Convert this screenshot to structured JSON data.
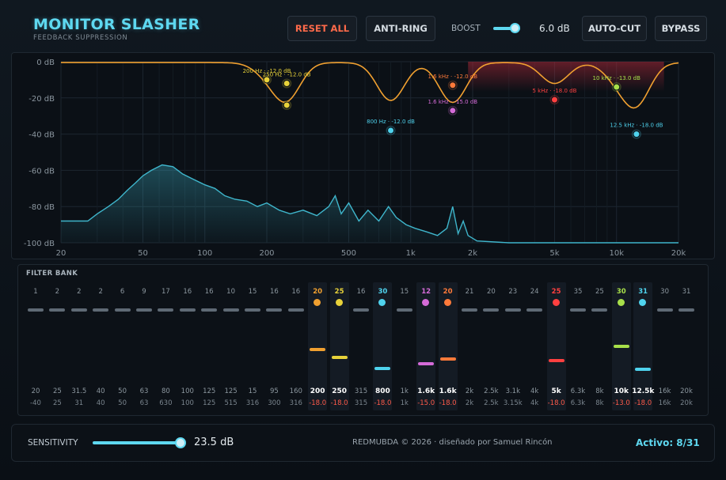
{
  "app": {
    "title": "MONITOR SLASHER",
    "subtitle": "FEEDBACK SUPPRESSION"
  },
  "toolbar": {
    "reset_label": "RESET ALL",
    "antiring_label": "ANTI-RING",
    "boost_label": "BOOST",
    "boost_value": "6.0 dB",
    "boost_level": 0.75,
    "autocut_label": "AUTO-CUT",
    "bypass_label": "BYPASS"
  },
  "spectrum": {
    "y_ticks": [
      "0 dB",
      "-20 dB",
      "-40 dB",
      "-60 dB",
      "-80 dB",
      "-100 dB"
    ],
    "y_values": [
      0,
      -20,
      -40,
      -60,
      -80,
      -100
    ],
    "x_ticks": [
      "20",
      "50",
      "100",
      "200",
      "500",
      "1k",
      "2k",
      "5k",
      "10k",
      "20k"
    ],
    "x_values": [
      20,
      50,
      100,
      200,
      500,
      1000,
      2000,
      5000,
      10000,
      20000
    ],
    "colors": {
      "curve": "#f0a030",
      "spectrum": "#3fb6cc",
      "cut_zone": "#a82838"
    },
    "notches": [
      {
        "freq": 200,
        "depth": -10,
        "color": "#e8d23a",
        "label": "200 Hz · -12.0 dB"
      },
      {
        "freq": 250,
        "depth": -12,
        "color": "#e8d23a",
        "label": "250 Hz · -12.0 dB"
      },
      {
        "freq": 250,
        "depth": -24,
        "color": "#e8d23a",
        "label": ""
      },
      {
        "freq": 800,
        "depth": -38,
        "color": "#4fd3ee",
        "label": "800 Hz · -12.0 dB"
      },
      {
        "freq": 1600,
        "depth": -27,
        "color": "#d56bd8",
        "label": "1.6 kHz · -15.0 dB"
      },
      {
        "freq": 1600,
        "depth": -13,
        "color": "#ff7a3a",
        "label": "1.6 kHz · -12.0 dB"
      },
      {
        "freq": 5000,
        "depth": -21,
        "color": "#ff4040",
        "label": "5 kHz · -18.0 dB"
      },
      {
        "freq": 10000,
        "depth": -14,
        "color": "#a8e04a",
        "label": "10 kHz · -13.0 dB"
      },
      {
        "freq": 12500,
        "depth": -40,
        "color": "#4fd3ee",
        "label": "12.5 kHz · -18.0 dB"
      }
    ]
  },
  "filterbank": {
    "title": "FILTER BANK",
    "bands": [
      {
        "num": "1",
        "freq": "20",
        "gain": "-40"
      },
      {
        "num": "2",
        "freq": "25",
        "gain": "25"
      },
      {
        "num": "2",
        "freq": "31.5",
        "gain": "31"
      },
      {
        "num": "2",
        "freq": "40",
        "gain": "40"
      },
      {
        "num": "6",
        "freq": "50",
        "gain": "50"
      },
      {
        "num": "9",
        "freq": "63",
        "gain": "63"
      },
      {
        "num": "17",
        "freq": "80",
        "gain": "630"
      },
      {
        "num": "16",
        "freq": "100",
        "gain": "100"
      },
      {
        "num": "16",
        "freq": "125",
        "gain": "125"
      },
      {
        "num": "10",
        "freq": "125",
        "gain": "515"
      },
      {
        "num": "15",
        "freq": "15",
        "gain": "316"
      },
      {
        "num": "16",
        "freq": "95",
        "gain": "300"
      },
      {
        "num": "16",
        "freq": "160",
        "gain": "316"
      },
      {
        "num": "20",
        "freq": "200",
        "gain": "-18.0",
        "active": true,
        "color": "#f0a030",
        "cut": 0.62
      },
      {
        "num": "25",
        "freq": "250",
        "gain": "-18.0",
        "active": true,
        "color": "#e8d23a",
        "cut": 0.75
      },
      {
        "num": "16",
        "freq": "315",
        "gain": "315"
      },
      {
        "num": "30",
        "freq": "800",
        "gain": "-18.0",
        "active": true,
        "color": "#4fd3ee",
        "cut": 0.95
      },
      {
        "num": "15",
        "freq": "1k",
        "gain": "1k"
      },
      {
        "num": "12",
        "freq": "1.6k",
        "gain": "-15.0",
        "active": true,
        "color": "#d56bd8",
        "cut": 0.87
      },
      {
        "num": "20",
        "freq": "1.6k",
        "gain": "-18.0",
        "active": true,
        "color": "#ff7a3a",
        "cut": 0.78
      },
      {
        "num": "21",
        "freq": "2k",
        "gain": "2k"
      },
      {
        "num": "20",
        "freq": "2.5k",
        "gain": "2.5k"
      },
      {
        "num": "23",
        "freq": "3.1k",
        "gain": "3.15k"
      },
      {
        "num": "24",
        "freq": "4k",
        "gain": "4k"
      },
      {
        "num": "25",
        "freq": "5k",
        "gain": "-18.0",
        "active": true,
        "color": "#ff4040",
        "cut": 0.82
      },
      {
        "num": "35",
        "freq": "6.3k",
        "gain": "6.3k"
      },
      {
        "num": "25",
        "freq": "8k",
        "gain": "8k"
      },
      {
        "num": "30",
        "freq": "10k",
        "gain": "-13.0",
        "active": true,
        "color": "#a8e04a",
        "cut": 0.55
      },
      {
        "num": "31",
        "freq": "12.5k",
        "gain": "-18.0",
        "active": true,
        "color": "#4fd3ee",
        "cut": 0.97
      },
      {
        "num": "30",
        "freq": "16k",
        "gain": "16k"
      },
      {
        "num": "31",
        "freq": "20k",
        "gain": "20k"
      }
    ]
  },
  "footer": {
    "sensitivity_label": "SENSITIVITY",
    "sensitivity_value": "23.5 dB",
    "sensitivity_level": 0.9,
    "credit": "REDMUBDA © 2026 · diseñado por Samuel Rincón",
    "active_label": "Activo: 8/31"
  }
}
